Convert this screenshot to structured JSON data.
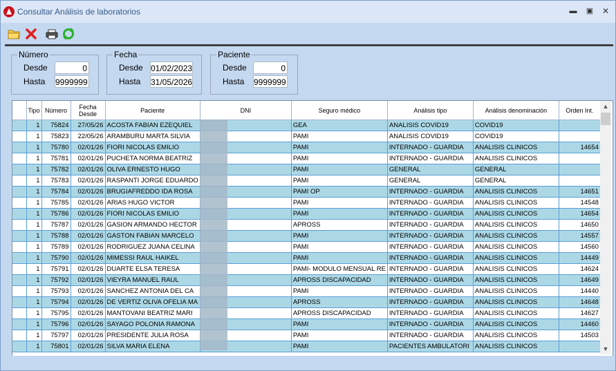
{
  "window": {
    "title": "Consultar Análisis de laboratorios"
  },
  "filters": {
    "numero": {
      "legend": "Número",
      "desde_label": "Desde",
      "desde": "0",
      "hasta_label": "Hasta",
      "hasta": "9999999"
    },
    "fecha": {
      "legend": "Fecha",
      "desde_label": "Desde",
      "desde": "01/02/2023",
      "hasta_label": "Hasta",
      "hasta": "31/05/2026"
    },
    "paciente": {
      "legend": "Paciente",
      "desde_label": "Desde",
      "desde": "0",
      "hasta_label": "Hasta",
      "hasta": "9999999"
    }
  },
  "columns": [
    "Tipo",
    "Número",
    "Fecha Desde",
    "Paciente",
    "DNI",
    "Seguro médico",
    "Análisis tipo",
    "Análisis denominación",
    "Orden Int."
  ],
  "rows": [
    [
      "1",
      "75824",
      "27/05/26",
      "ACOSTA FABIAN EZEQUIEL",
      "",
      "GEA",
      "ANALISIS COVID19",
      "COVID19",
      ""
    ],
    [
      "1",
      "75823",
      "22/05/26",
      "ARAMBURU MARTA SILVIA",
      "",
      "PAMI",
      "ANALISIS COVID19",
      "COVID19",
      ""
    ],
    [
      "1",
      "75780",
      "02/01/26",
      "FIORI NICOLAS EMILIO",
      "",
      "PAMI",
      "INTERNADO - GUARDIA",
      "ANALISIS CLINICOS",
      "14654"
    ],
    [
      "1",
      "75781",
      "02/01/26",
      "PUCHETA NORMA BEATRIZ",
      "",
      "PAMI",
      "INTERNADO - GUARDIA",
      "ANALISIS CLINICOS",
      ""
    ],
    [
      "1",
      "75782",
      "02/01/26",
      "OLIVA ERNESTO HUGO",
      "",
      "PAMI",
      "GENERAL",
      "GENERAL",
      ""
    ],
    [
      "1",
      "75783",
      "02/01/26",
      "RASPANTI JORGE EDUARDO",
      "",
      "PAMI",
      "GENERAL",
      "GENERAL",
      ""
    ],
    [
      "1",
      "75784",
      "02/01/26",
      "BRUGIAFREDDO IDA ROSA",
      "",
      "PAMI OP",
      "INTERNADO - GUARDIA",
      "ANALISIS CLINICOS",
      "14651"
    ],
    [
      "1",
      "75785",
      "02/01/26",
      "ARIAS HUGO VICTOR",
      "",
      "PAMI",
      "INTERNADO - GUARDIA",
      "ANALISIS CLINICOS",
      "14548"
    ],
    [
      "1",
      "75786",
      "02/01/26",
      "FIORI NICOLAS EMILIO",
      "",
      "PAMI",
      "INTERNADO - GUARDIA",
      "ANALISIS CLINICOS",
      "14654"
    ],
    [
      "1",
      "75787",
      "02/01/26",
      "GASION ARMANDO HECTOR",
      "",
      "APROSS",
      "INTERNADO - GUARDIA",
      "ANALISIS CLINICOS",
      "14650"
    ],
    [
      "1",
      "75788",
      "02/01/26",
      "GASTON FABIAN MARCELO",
      "",
      "PAMI",
      "INTERNADO - GUARDIA",
      "ANALISIS CLINICOS",
      "14557"
    ],
    [
      "1",
      "75789",
      "02/01/26",
      "RODRIGUEZ JUANA CELINA",
      "",
      "PAMI",
      "INTERNADO - GUARDIA",
      "ANALISIS CLINICOS",
      "14560"
    ],
    [
      "1",
      "75790",
      "02/01/26",
      "MIMESSI RAUL HAIKEL",
      "",
      "PAMI",
      "INTERNADO - GUARDIA",
      "ANALISIS CLINICOS",
      "14449"
    ],
    [
      "1",
      "75791",
      "02/01/26",
      "DUARTE ELSA TERESA",
      "",
      "PAMI- MODULO MENSUAL RE",
      "INTERNADO - GUARDIA",
      "ANALISIS CLINICOS",
      "14624"
    ],
    [
      "1",
      "75792",
      "02/01/26",
      "VIEYRA MANUEL RAUL",
      "",
      "APROSS DISCAPACIDAD",
      "INTERNADO - GUARDIA",
      "ANALISIS CLINICOS",
      "14649"
    ],
    [
      "1",
      "75793",
      "02/01/26",
      "SANCHEZ ANTONIA DEL CA",
      "",
      "PAMI",
      "INTERNADO - GUARDIA",
      "ANALISIS CLINICOS",
      "14440"
    ],
    [
      "1",
      "75794",
      "02/01/26",
      "DE VERTIZ OLIVA OFELIA MA",
      "",
      "APROSS",
      "INTERNADO - GUARDIA",
      "ANALISIS CLINICOS",
      "14648"
    ],
    [
      "1",
      "75795",
      "02/01/26",
      "MANTOVANI BEATRIZ MARI",
      "",
      "APROSS DISCAPACIDAD",
      "INTERNADO - GUARDIA",
      "ANALISIS CLINICOS",
      "14627"
    ],
    [
      "1",
      "75796",
      "02/01/26",
      "SAYAGO POLONIA RAMONA",
      "",
      "PAMI",
      "INTERNADO - GUARDIA",
      "ANALISIS CLINICOS",
      "14460"
    ],
    [
      "1",
      "75797",
      "02/01/26",
      "PRESIDENTE JULIA ROSA",
      "",
      "PAMI",
      "INTERNADO - GUARDIA",
      "ANALISIS CLINICOS",
      "14503"
    ],
    [
      "1",
      "75801",
      "02/01/26",
      "SILVA MARIA ELENA",
      "",
      "PAMI",
      "PACIENTES AMBULATORI",
      "ANALISIS CLINICOS",
      ""
    ]
  ],
  "colors": {
    "alt_row": "#acd8e6",
    "grid_line": "#5a9dd6",
    "window_bg": "#c4d8f0"
  }
}
